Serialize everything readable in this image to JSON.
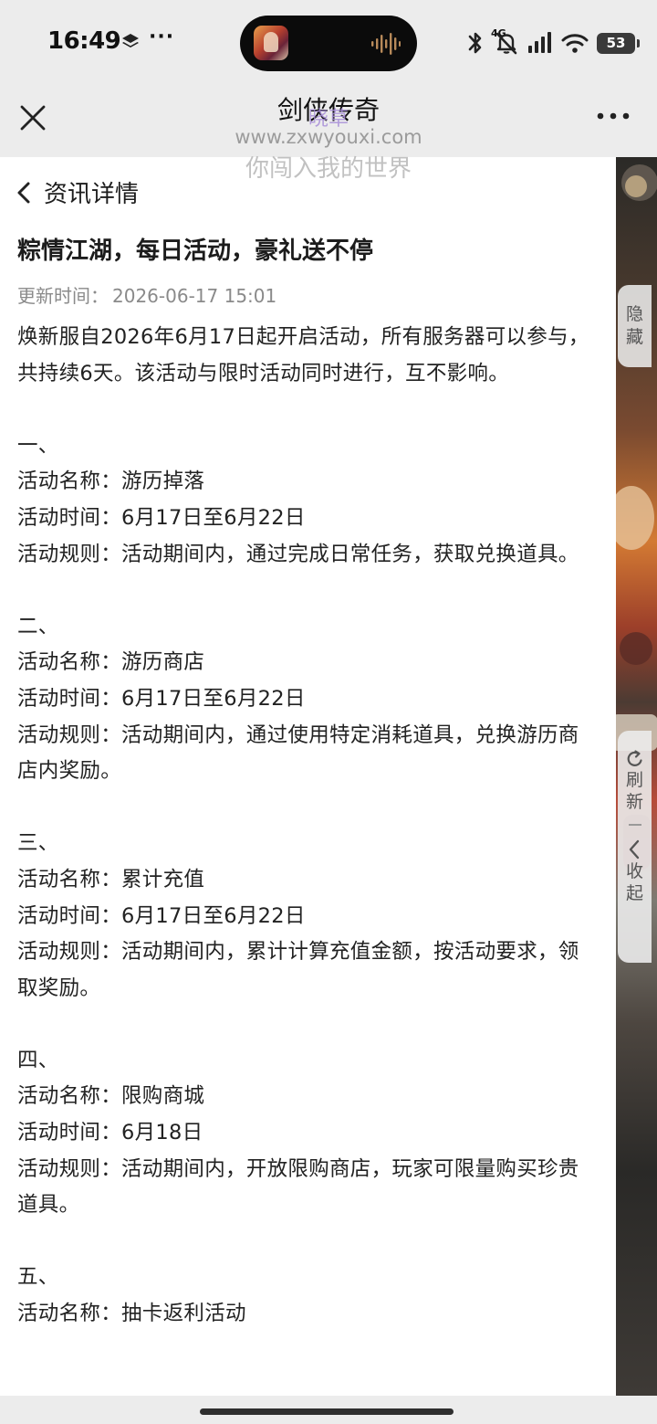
{
  "status_bar": {
    "time": "16:49",
    "overflow": "···",
    "network": "4G",
    "battery": "53",
    "icons": [
      "layers-icon",
      "sound-wave-icon",
      "bluetooth-icon",
      "mute-bell-icon",
      "signal-icon",
      "wifi-icon",
      "battery-icon"
    ]
  },
  "nav": {
    "title": "剑侠传奇",
    "close_icon": "close-icon",
    "more_icon": "more-icon"
  },
  "watermark": {
    "overlay": "晓草",
    "url": "www.zxwyouxi.com",
    "slogan": "你闯入我的世界"
  },
  "page": {
    "back_label": "资讯详情",
    "title": "粽情江湖，每日活动，豪礼送不停",
    "update_label": "更新时间：",
    "update_time": "2026-06-17 15:01",
    "intro": "焕新服自2026年6月17日起开启活动，所有服务器可以参与，共持续6天。该活动与限时活动同时进行，互不影响。",
    "sections": [
      {
        "number": "一、",
        "name": "活动名称：游历掉落",
        "time": "活动时间：6月17日至6月22日",
        "rule": "活动规则：活动期间内，通过完成日常任务，获取兑换道具。"
      },
      {
        "number": "二、",
        "name": "活动名称：游历商店",
        "time": "活动时间：6月17日至6月22日",
        "rule": "活动规则：活动期间内，通过使用特定消耗道具，兑换游历商店内奖励。"
      },
      {
        "number": "三、",
        "name": "活动名称：累计充值",
        "time": "活动时间：6月17日至6月22日",
        "rule": "活动规则：活动期间内，累计计算充值金额，按活动要求，领取奖励。"
      },
      {
        "number": "四、",
        "name": "活动名称：限购商城",
        "time": "活动时间：6月18日",
        "rule": "活动规则：活动期间内，开放限购商店，玩家可限量购买珍贵道具。"
      },
      {
        "number": "五、",
        "name": "活动名称：抽卡返利活动"
      }
    ]
  },
  "side": {
    "hide_label": [
      "隐",
      "藏"
    ],
    "refresh_label": [
      "刷",
      "新"
    ],
    "collapse_label": [
      "收",
      "起"
    ],
    "divider": "—"
  },
  "colors": {
    "accent_watermark": "#a88fd9",
    "text_primary": "#1c1c1c",
    "text_secondary": "#8a8a8a",
    "background": "#ececec",
    "card": "#ffffff"
  }
}
